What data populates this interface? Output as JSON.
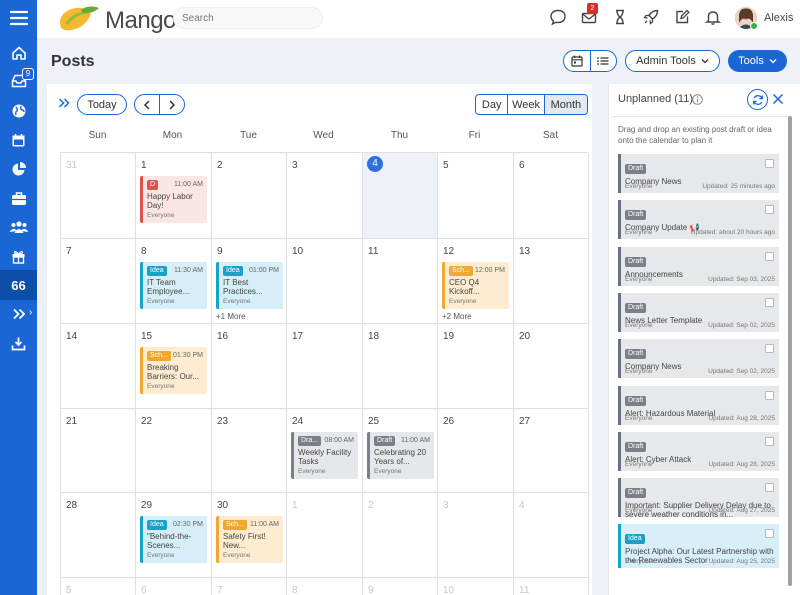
{
  "app": {
    "logo_text": "Mango",
    "search_placeholder": "Search",
    "user_name": "Alexis",
    "mail_badge": "2"
  },
  "rail": {
    "inbox_badge": "9",
    "active_label": "66"
  },
  "page": {
    "title": "Posts"
  },
  "header_buttons": {
    "admin_tools": "Admin Tools",
    "tools": "Tools"
  },
  "calendar": {
    "today_label": "Today",
    "range_options": [
      "Day",
      "Week",
      "Month"
    ],
    "active_range": "Month",
    "weekdays": [
      "Sun",
      "Mon",
      "Tue",
      "Wed",
      "Thu",
      "Fri",
      "Sat"
    ],
    "weeks": [
      [
        {
          "d": "31",
          "dim": true
        },
        {
          "d": "1"
        },
        {
          "d": "2"
        },
        {
          "d": "3"
        },
        {
          "d": "4",
          "today": true
        },
        {
          "d": "5"
        },
        {
          "d": "6"
        }
      ],
      [
        {
          "d": "7"
        },
        {
          "d": "8"
        },
        {
          "d": "9"
        },
        {
          "d": "10"
        },
        {
          "d": "11"
        },
        {
          "d": "12"
        },
        {
          "d": "13"
        }
      ],
      [
        {
          "d": "14"
        },
        {
          "d": "15"
        },
        {
          "d": "16"
        },
        {
          "d": "17"
        },
        {
          "d": "18"
        },
        {
          "d": "19"
        },
        {
          "d": "20"
        }
      ],
      [
        {
          "d": "21"
        },
        {
          "d": "22"
        },
        {
          "d": "23"
        },
        {
          "d": "24"
        },
        {
          "d": "25"
        },
        {
          "d": "26"
        },
        {
          "d": "27"
        }
      ],
      [
        {
          "d": "28"
        },
        {
          "d": "29"
        },
        {
          "d": "30"
        },
        {
          "d": "1",
          "dim": true
        },
        {
          "d": "2",
          "dim": true
        },
        {
          "d": "3",
          "dim": true
        },
        {
          "d": "4",
          "dim": true
        }
      ],
      [
        {
          "d": "5",
          "dim": true
        },
        {
          "d": "6",
          "dim": true
        },
        {
          "d": "7",
          "dim": true
        },
        {
          "d": "8",
          "dim": true
        },
        {
          "d": "9",
          "dim": true
        },
        {
          "d": "10",
          "dim": true
        },
        {
          "d": "11",
          "dim": true
        }
      ]
    ],
    "events": [
      {
        "week": 0,
        "day": 1,
        "tag": "D",
        "kind": "draft",
        "time": "11:00 AM",
        "title": "Happy Labor Day!",
        "audience": "Everyone"
      },
      {
        "week": 1,
        "day": 1,
        "tag": "Idea",
        "kind": "idea",
        "time": "11:30 AM",
        "title": "IT Team Employee...",
        "audience": "Everyone"
      },
      {
        "week": 1,
        "day": 2,
        "tag": "Idea",
        "kind": "idea",
        "time": "01:00 PM",
        "title": "IT Best Practices...",
        "audience": "Everyone",
        "more": "+1 More"
      },
      {
        "week": 1,
        "day": 5,
        "tag": "Sch...",
        "kind": "scheduled",
        "time": "12:00 PM",
        "title": "CEO Q4 Kickoff...",
        "audience": "Everyone",
        "more": "+2 More"
      },
      {
        "week": 2,
        "day": 1,
        "tag": "Sch...",
        "kind": "scheduled",
        "time": "01:30 PM",
        "title": "Breaking Barriers: Our...",
        "audience": "Everyone"
      },
      {
        "week": 3,
        "day": 3,
        "tag": "Dra...",
        "kind": "gray",
        "time": "08:00 AM",
        "title": "Weekly Facility Tasks",
        "audience": "Everyone"
      },
      {
        "week": 3,
        "day": 4,
        "tag": "Draft",
        "kind": "gray",
        "time": "11:00 AM",
        "title": "Celebrating 20 Years of...",
        "audience": "Everyone"
      },
      {
        "week": 4,
        "day": 1,
        "tag": "Idea",
        "kind": "idea",
        "time": "02:30 PM",
        "title": "\"Behind-the-Scenes...",
        "audience": "Everyone"
      },
      {
        "week": 4,
        "day": 2,
        "tag": "Sch...",
        "kind": "scheduled",
        "time": "11:00 AM",
        "title": "Safety First! New...",
        "audience": "Everyone"
      }
    ]
  },
  "unplanned": {
    "title": "Unplanned (11)",
    "hint": "Drag and drop an existing post draft or idea onto the calendar to plan it",
    "items": [
      {
        "tag": "Draft",
        "title": "Company News",
        "audience": "Everyone",
        "updated": "Updated: 25 minutes ago"
      },
      {
        "tag": "Draft",
        "title": "Company Update 📢",
        "audience": "Everyone",
        "updated": "Updated: about 20 hours ago"
      },
      {
        "tag": "Draft",
        "title": "Announcements",
        "audience": "Everyone",
        "updated": "Updated: Sep 03, 2025"
      },
      {
        "tag": "Draft",
        "title": "News Letter Template",
        "audience": "Everyone",
        "updated": "Updated: Sep 02, 2025"
      },
      {
        "tag": "Draft",
        "title": "Company News",
        "audience": "Everyone",
        "updated": "Updated: Sep 02, 2025"
      },
      {
        "tag": "Draft",
        "title": "Alert: Hazardous Material",
        "audience": "Everyone",
        "updated": "Updated: Aug 28, 2025"
      },
      {
        "tag": "Draft",
        "title": "Alert: Cyber Attack",
        "audience": "Everyone",
        "updated": "Updated: Aug 28, 2025"
      },
      {
        "tag": "Draft",
        "title": "Important: Supplier Delivery Delay due to severe weather conditions in...",
        "audience": "Everyone",
        "updated": "Updated: Aug 27, 2025"
      },
      {
        "tag": "Idea",
        "kind": "idea",
        "title": "Project Alpha: Our Latest Partnership with the Renewables Sector",
        "audience": "Everyone",
        "updated": "Updated: Aug 25, 2025"
      }
    ]
  },
  "colors": {
    "primary": "#1a66d4",
    "draft": "#d9534f",
    "idea": "#17a2c7",
    "scheduled": "#f0a830",
    "gray": "#7a7f88"
  }
}
